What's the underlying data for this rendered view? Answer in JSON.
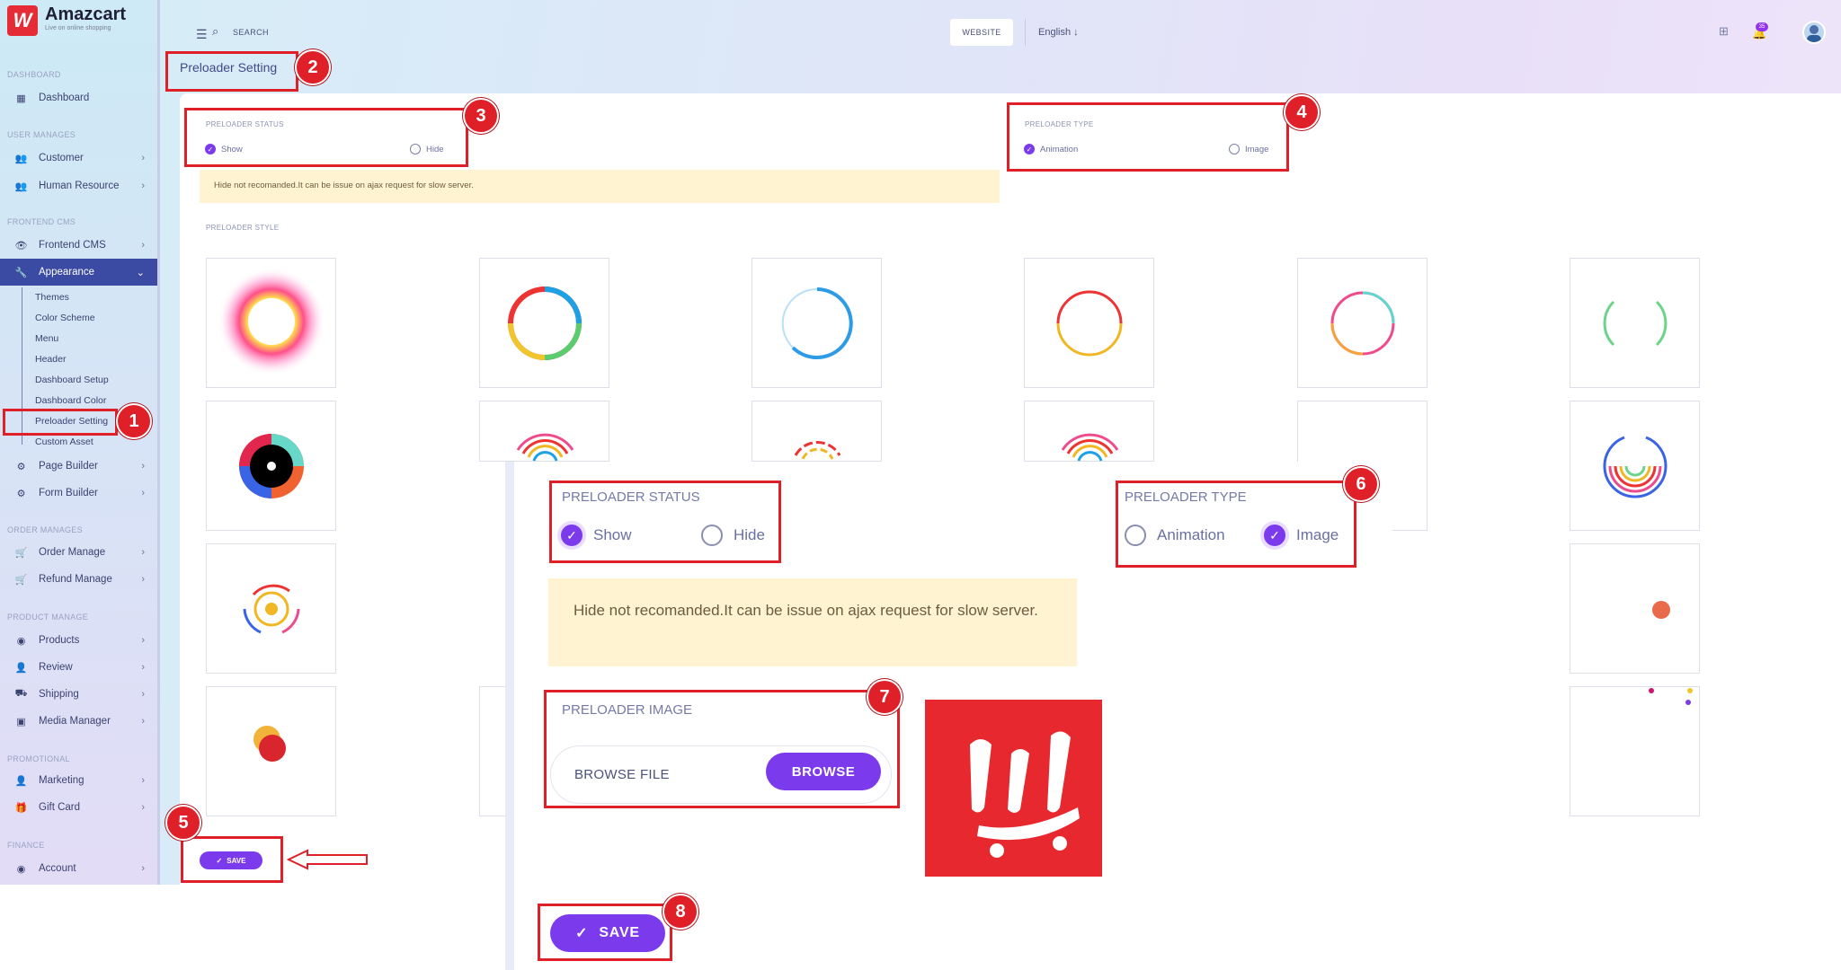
{
  "brand": {
    "name": "Amazcart",
    "tagline": "Live on online shopping",
    "logo_text": "W"
  },
  "sidebar": {
    "sections": [
      "DASHBOARD",
      "USER MANAGES",
      "FRONTEND CMS",
      "ORDER MANAGES",
      "PRODUCT MANAGE",
      "PROMOTIONAL",
      "FINANCE"
    ],
    "items": [
      {
        "label": "Dashboard",
        "icon": "grid-icon"
      },
      {
        "label": "Customer",
        "icon": "users-icon"
      },
      {
        "label": "Human Resource",
        "icon": "users-icon"
      },
      {
        "label": "Frontend CMS",
        "icon": "eye-icon"
      },
      {
        "label": "Appearance",
        "icon": "wrench-icon"
      },
      {
        "label": "Page Builder",
        "icon": "gears-icon"
      },
      {
        "label": "Form Builder",
        "icon": "gears-icon"
      },
      {
        "label": "Order Manage",
        "icon": "cart-icon"
      },
      {
        "label": "Refund Manage",
        "icon": "cart-icon"
      },
      {
        "label": "Products",
        "icon": "product-icon"
      },
      {
        "label": "Review",
        "icon": "user-icon"
      },
      {
        "label": "Shipping",
        "icon": "truck-icon"
      },
      {
        "label": "Media Manager",
        "icon": "image-icon"
      },
      {
        "label": "Marketing",
        "icon": "user-icon"
      },
      {
        "label": "Gift Card",
        "icon": "gift-icon"
      },
      {
        "label": "Account",
        "icon": "account-icon"
      }
    ],
    "appearance_sub": [
      "Themes",
      "Color Scheme",
      "Menu",
      "Header",
      "Dashboard Setup",
      "Dashboard Color",
      "Preloader Setting",
      "Custom Asset"
    ]
  },
  "topbar": {
    "search_label": "SEARCH",
    "website": "WEBSITE",
    "language": "English",
    "notif_count": "35"
  },
  "page": {
    "title": "Preloader Setting"
  },
  "form": {
    "status_label": "PRELOADER STATUS",
    "show": "Show",
    "hide": "Hide",
    "type_label": "PRELOADER TYPE",
    "animation": "Animation",
    "image": "Image",
    "warning": "Hide not recomanded.It can be issue on ajax request for slow server.",
    "style_label": "PRELOADER STYLE",
    "save": "SAVE"
  },
  "overlay": {
    "status_label": "PRELOADER STATUS",
    "show": "Show",
    "hide": "Hide",
    "type_label": "PRELOADER TYPE",
    "animation": "Animation",
    "image": "Image",
    "warning": "Hide not recomanded.It can be issue on ajax request for slow server.",
    "image_label": "PRELOADER IMAGE",
    "file_placeholder": "BROWSE FILE",
    "browse": "BROWSE",
    "save": "SAVE"
  },
  "callouts": [
    "1",
    "2",
    "3",
    "4",
    "5",
    "6",
    "7",
    "8"
  ],
  "colors": {
    "accent": "#7c3aed",
    "callout": "#e02028",
    "active_nav": "#3b4aa3",
    "warning_bg": "#fff3d2"
  }
}
